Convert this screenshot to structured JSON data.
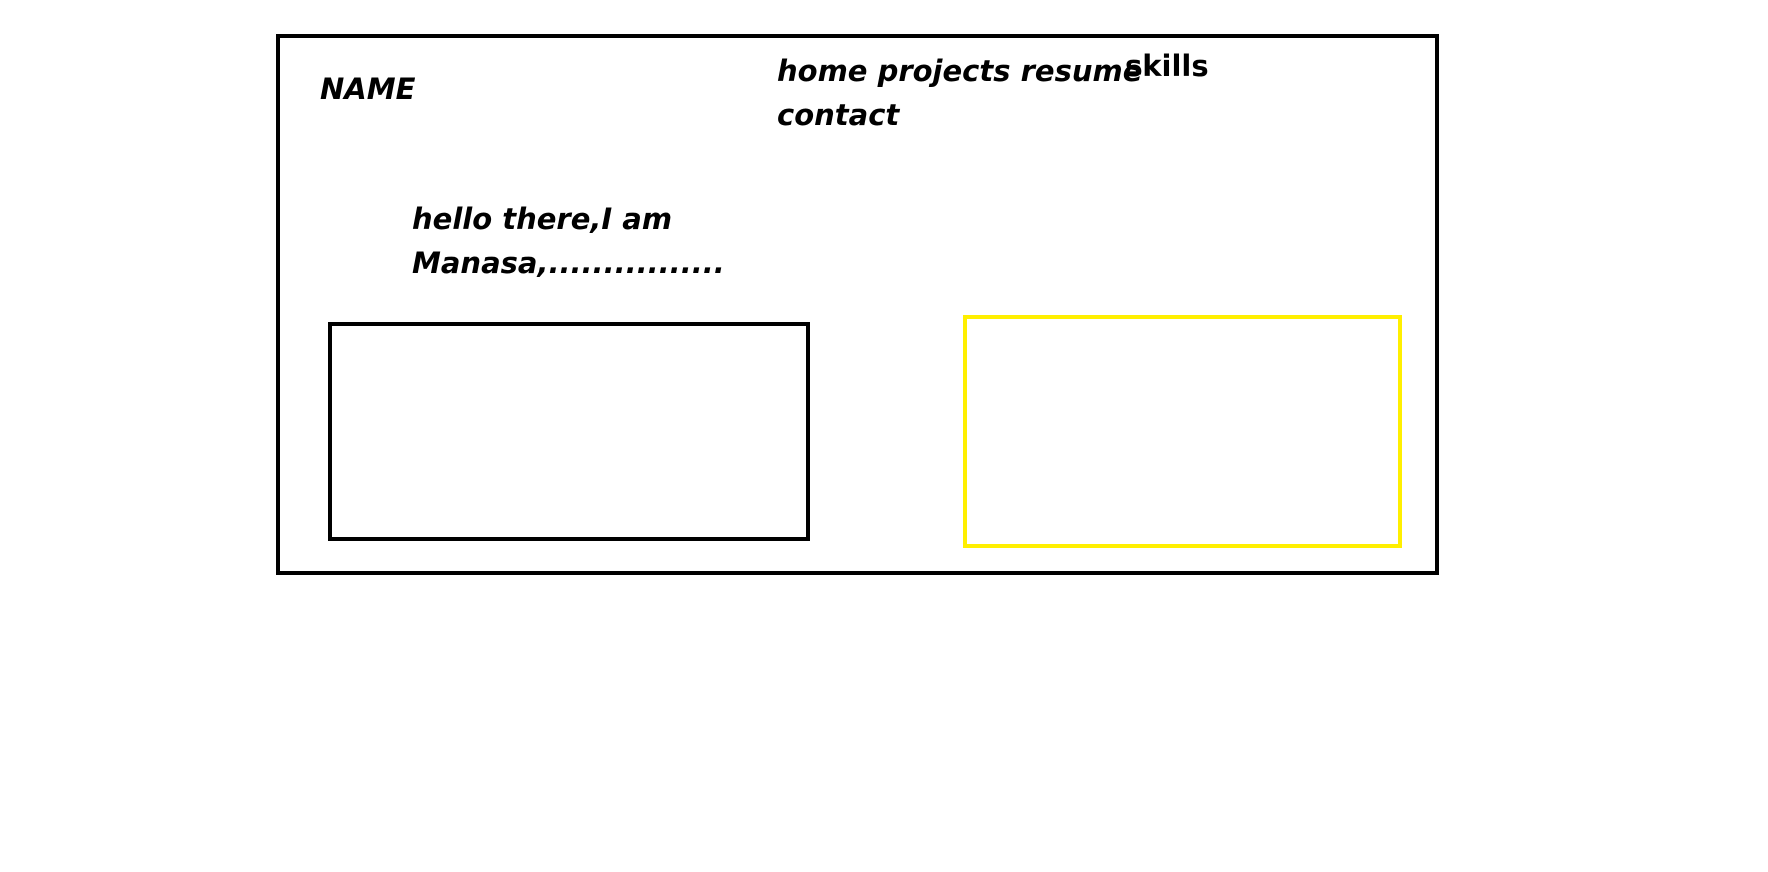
{
  "header": {
    "name": "NAME",
    "nav": {
      "home": "home",
      "projects": "projects",
      "resume": "resume",
      "skills": "skills",
      "contact": "contact"
    }
  },
  "intro": {
    "line1": "hello there,I am",
    "line2": "Manasa,................"
  },
  "colors": {
    "frame": "#000000",
    "left_box": "#000000",
    "right_box": "#ffef00",
    "text": "#000000"
  }
}
